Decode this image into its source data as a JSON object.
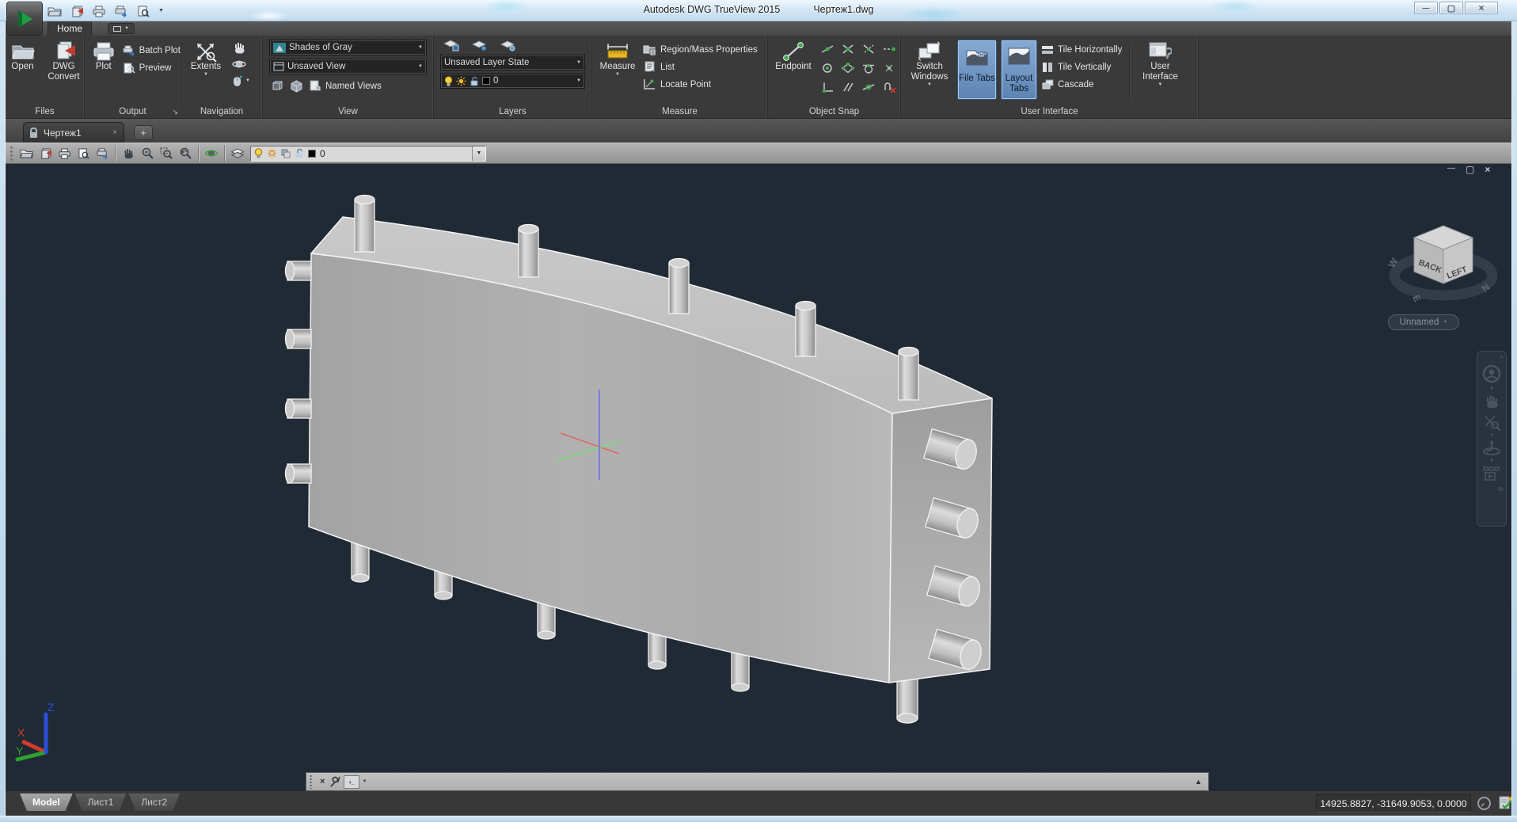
{
  "titlebar": {
    "app": "Autodesk DWG TrueView 2015",
    "doc": "Чертеж1.dwg"
  },
  "glyphs": {
    "dropdown": "▼",
    "up_arrow": "▲",
    "close": "×",
    "minimize": "—",
    "restore": "▢",
    "plus": "+",
    "launcher": "↘",
    "prompt": "›_"
  },
  "ribbon": {
    "tab_home": "Home",
    "files": {
      "label": "Files",
      "open": "Open",
      "convert": "DWG Convert"
    },
    "output": {
      "label": "Output",
      "plot": "Plot",
      "batch": "Batch Plot",
      "preview": "Preview"
    },
    "navigation": {
      "label": "Navigation",
      "extents": "Extents"
    },
    "view": {
      "label": "View",
      "visual_style": "Shades of Gray",
      "view_state": "Unsaved View",
      "named_views": "Named Views"
    },
    "layers": {
      "label": "Layers",
      "layer_state": "Unsaved Layer State",
      "layer_name": "0"
    },
    "measure": {
      "label": "Measure",
      "measure": "Measure",
      "region": "Region/Mass Properties",
      "list": "List",
      "locate": "Locate Point"
    },
    "osnap": {
      "label": "Object Snap",
      "endpoint": "Endpoint"
    },
    "ui": {
      "label": "User Interface",
      "switch": "Switch Windows",
      "file_tabs": "File Tabs",
      "layout_tabs": "Layout Tabs",
      "tile_h": "Tile Horizontally",
      "tile_v": "Tile Vertically",
      "cascade": "Cascade",
      "user_interface": "User Interface"
    }
  },
  "filetab": {
    "name": "Чертеж1"
  },
  "toolbar": {
    "layer_value": "0"
  },
  "viewport": {
    "viewcube": {
      "face_left": "BACK",
      "face_right": "LEFT",
      "compass_w": "W",
      "compass_n": "N",
      "compass_e": "E",
      "view_pill": "Unnamed"
    },
    "ucs": {
      "x": "X",
      "y": "Y",
      "z": "Z"
    }
  },
  "sheet_tabs": {
    "model": "Model",
    "sheet1": "Лист1",
    "sheet2": "Лист2"
  },
  "statusbar": {
    "coords": "14925.8827, -31649.9053, 0.0000"
  },
  "colors": {
    "viewport_bg": "#202a35",
    "ribbon_bg": "#3a3a3a",
    "toggle_blue": "#7aa0cc",
    "model_gray": "#afafaf",
    "axis_x": "#d43c2a",
    "axis_y": "#2fa12f",
    "axis_z": "#2a4fd8"
  }
}
